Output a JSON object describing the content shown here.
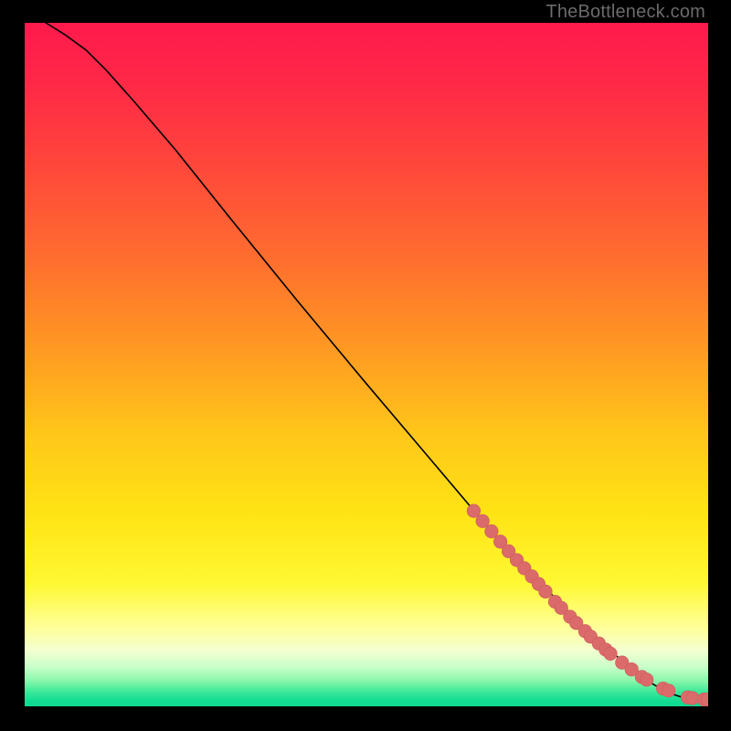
{
  "watermark": "TheBottleneck.com",
  "colors": {
    "bg": "#000000",
    "line": "#000000",
    "marker_fill": "#db6b6b",
    "marker_stroke": "#d05f5f"
  },
  "gradient_stops": [
    {
      "offset": 0.0,
      "color": "#ff1a4d"
    },
    {
      "offset": 0.1,
      "color": "#ff2b46"
    },
    {
      "offset": 0.22,
      "color": "#ff4a3a"
    },
    {
      "offset": 0.35,
      "color": "#ff6f2e"
    },
    {
      "offset": 0.48,
      "color": "#ff9a22"
    },
    {
      "offset": 0.6,
      "color": "#ffc61a"
    },
    {
      "offset": 0.72,
      "color": "#ffe414"
    },
    {
      "offset": 0.82,
      "color": "#fff833"
    },
    {
      "offset": 0.885,
      "color": "#ffff9a"
    },
    {
      "offset": 0.918,
      "color": "#f4ffd0"
    },
    {
      "offset": 0.942,
      "color": "#c9ffca"
    },
    {
      "offset": 0.962,
      "color": "#8cf7ac"
    },
    {
      "offset": 0.978,
      "color": "#3fe99a"
    },
    {
      "offset": 0.992,
      "color": "#12dc92"
    },
    {
      "offset": 1.0,
      "color": "#10d890"
    }
  ],
  "chart_data": {
    "type": "line",
    "title": "",
    "xlabel": "",
    "ylabel": "",
    "xlim": [
      0,
      100
    ],
    "ylim": [
      0,
      100
    ],
    "series": [
      {
        "name": "curve",
        "x": [
          3.1,
          6.0,
          9.0,
          12.0,
          16.0,
          22.0,
          30.0,
          40.0,
          50.0,
          60.0,
          66.0,
          70.0,
          75.0,
          80.0,
          84.0,
          87.0,
          89.0,
          90.5,
          92.0,
          93.5,
          95.0,
          96.3,
          97.3,
          98.3,
          99.3,
          99.9
        ],
        "y": [
          100.0,
          98.2,
          96.0,
          93.0,
          88.5,
          81.5,
          71.5,
          59.2,
          47.2,
          35.4,
          28.3,
          23.7,
          18.5,
          13.4,
          9.6,
          7.0,
          5.3,
          4.2,
          3.2,
          2.4,
          1.7,
          1.3,
          1.1,
          1.0,
          1.0,
          1.0
        ]
      }
    ],
    "markers": {
      "name": "highlighted-points",
      "x": [
        65.7,
        67.0,
        68.3,
        69.6,
        70.8,
        72.0,
        73.1,
        74.2,
        75.2,
        76.2,
        77.6,
        78.5,
        79.8,
        80.7,
        82.0,
        82.8,
        84.0,
        85.0,
        85.7,
        87.4,
        88.8,
        90.3,
        91.0,
        93.4,
        94.2,
        97.0,
        97.7,
        99.4,
        99.9
      ],
      "y": [
        28.6,
        27.1,
        25.6,
        24.1,
        22.7,
        21.4,
        20.2,
        19.0,
        17.9,
        16.8,
        15.3,
        14.4,
        13.1,
        12.2,
        11.0,
        10.2,
        9.2,
        8.3,
        7.7,
        6.4,
        5.4,
        4.3,
        3.9,
        2.6,
        2.3,
        1.3,
        1.2,
        1.0,
        1.0
      ]
    }
  }
}
